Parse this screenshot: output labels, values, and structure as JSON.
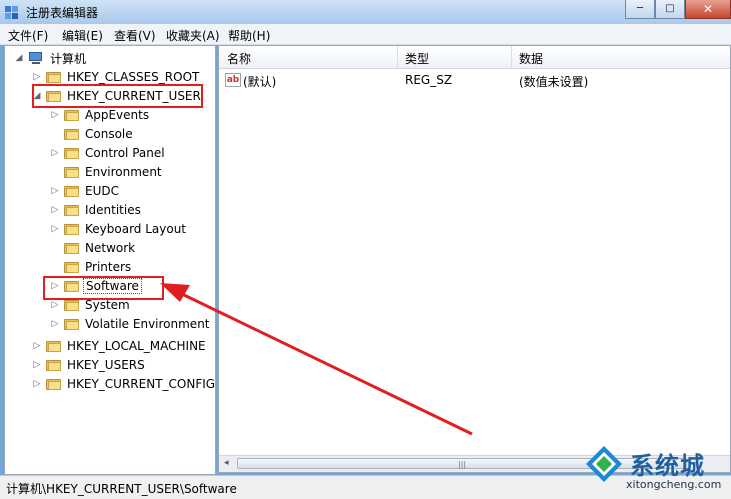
{
  "window": {
    "title": "注册表编辑器",
    "controls": {
      "minimize": "─",
      "maximize": "□",
      "close": "✕"
    }
  },
  "menu": [
    "文件(F)",
    "编辑(E)",
    "查看(V)",
    "收藏夹(A)",
    "帮助(H)"
  ],
  "tree": {
    "root": "计算机",
    "hkcr": "HKEY_CLASSES_ROOT",
    "hkcu": "HKEY_CURRENT_USER",
    "hkcu_children": [
      "AppEvents",
      "Console",
      "Control Panel",
      "Environment",
      "EUDC",
      "Identities",
      "Keyboard Layout",
      "Network",
      "Printers",
      "Software",
      "System",
      "Volatile Environment"
    ],
    "hklm": "HKEY_LOCAL_MACHINE",
    "hku": "HKEY_USERS",
    "hkcc": "HKEY_CURRENT_CONFIG",
    "selected": "Software"
  },
  "list": {
    "columns": [
      "名称",
      "类型",
      "数据"
    ],
    "rows": [
      {
        "icon": "ab",
        "name": "(默认)",
        "type": "REG_SZ",
        "data": "(数值未设置)"
      }
    ]
  },
  "status": {
    "path": "计算机\\HKEY_CURRENT_USER\\Software"
  },
  "watermark": {
    "name": "系统城",
    "url": "xitongcheng.com"
  },
  "colors": {
    "highlight": "#e02020",
    "annotation_arrow": "#e02020"
  }
}
